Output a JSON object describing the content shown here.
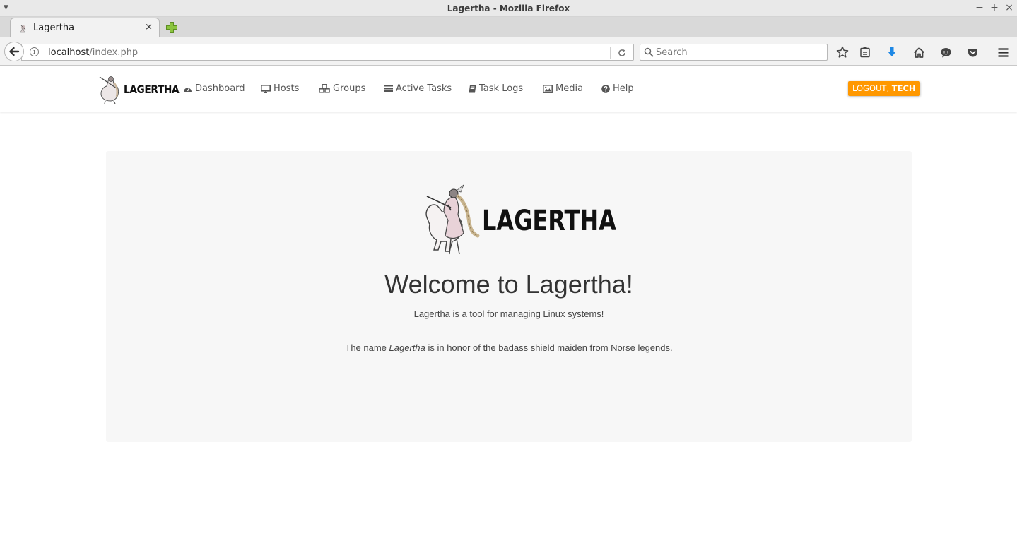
{
  "browser": {
    "window_title": "Lagertha - Mozilla Firefox",
    "tab_title": "Lagertha",
    "tab_close": "×",
    "url_host": "localhost",
    "url_path": "/index.php",
    "search_placeholder": "Search",
    "window_controls": {
      "minimize": "−",
      "maximize": "+",
      "close": "×"
    }
  },
  "app": {
    "brand": "LAGERTHA",
    "nav": [
      {
        "label": "Dashboard",
        "icon": "dashboard-icon"
      },
      {
        "label": "Hosts",
        "icon": "desktop-icon"
      },
      {
        "label": "Groups",
        "icon": "cubes-icon"
      },
      {
        "label": "Active Tasks",
        "icon": "tasks-icon"
      },
      {
        "label": "Task Logs",
        "icon": "book-icon"
      },
      {
        "label": "Media",
        "icon": "image-icon"
      },
      {
        "label": "Help",
        "icon": "question-circle-icon"
      }
    ],
    "logout": {
      "prefix": "LOGOUT, ",
      "user": "TECH",
      "color": "#ff9800"
    }
  },
  "hero": {
    "logo_text": "LAGERTHA",
    "title": "Welcome to Lagertha!",
    "subtitle": "Lagertha is a tool for managing Linux systems!",
    "name_pre": "The name ",
    "name_em": "Lagertha",
    "name_post": " is in honor of the badass shield maiden from Norse legends."
  }
}
